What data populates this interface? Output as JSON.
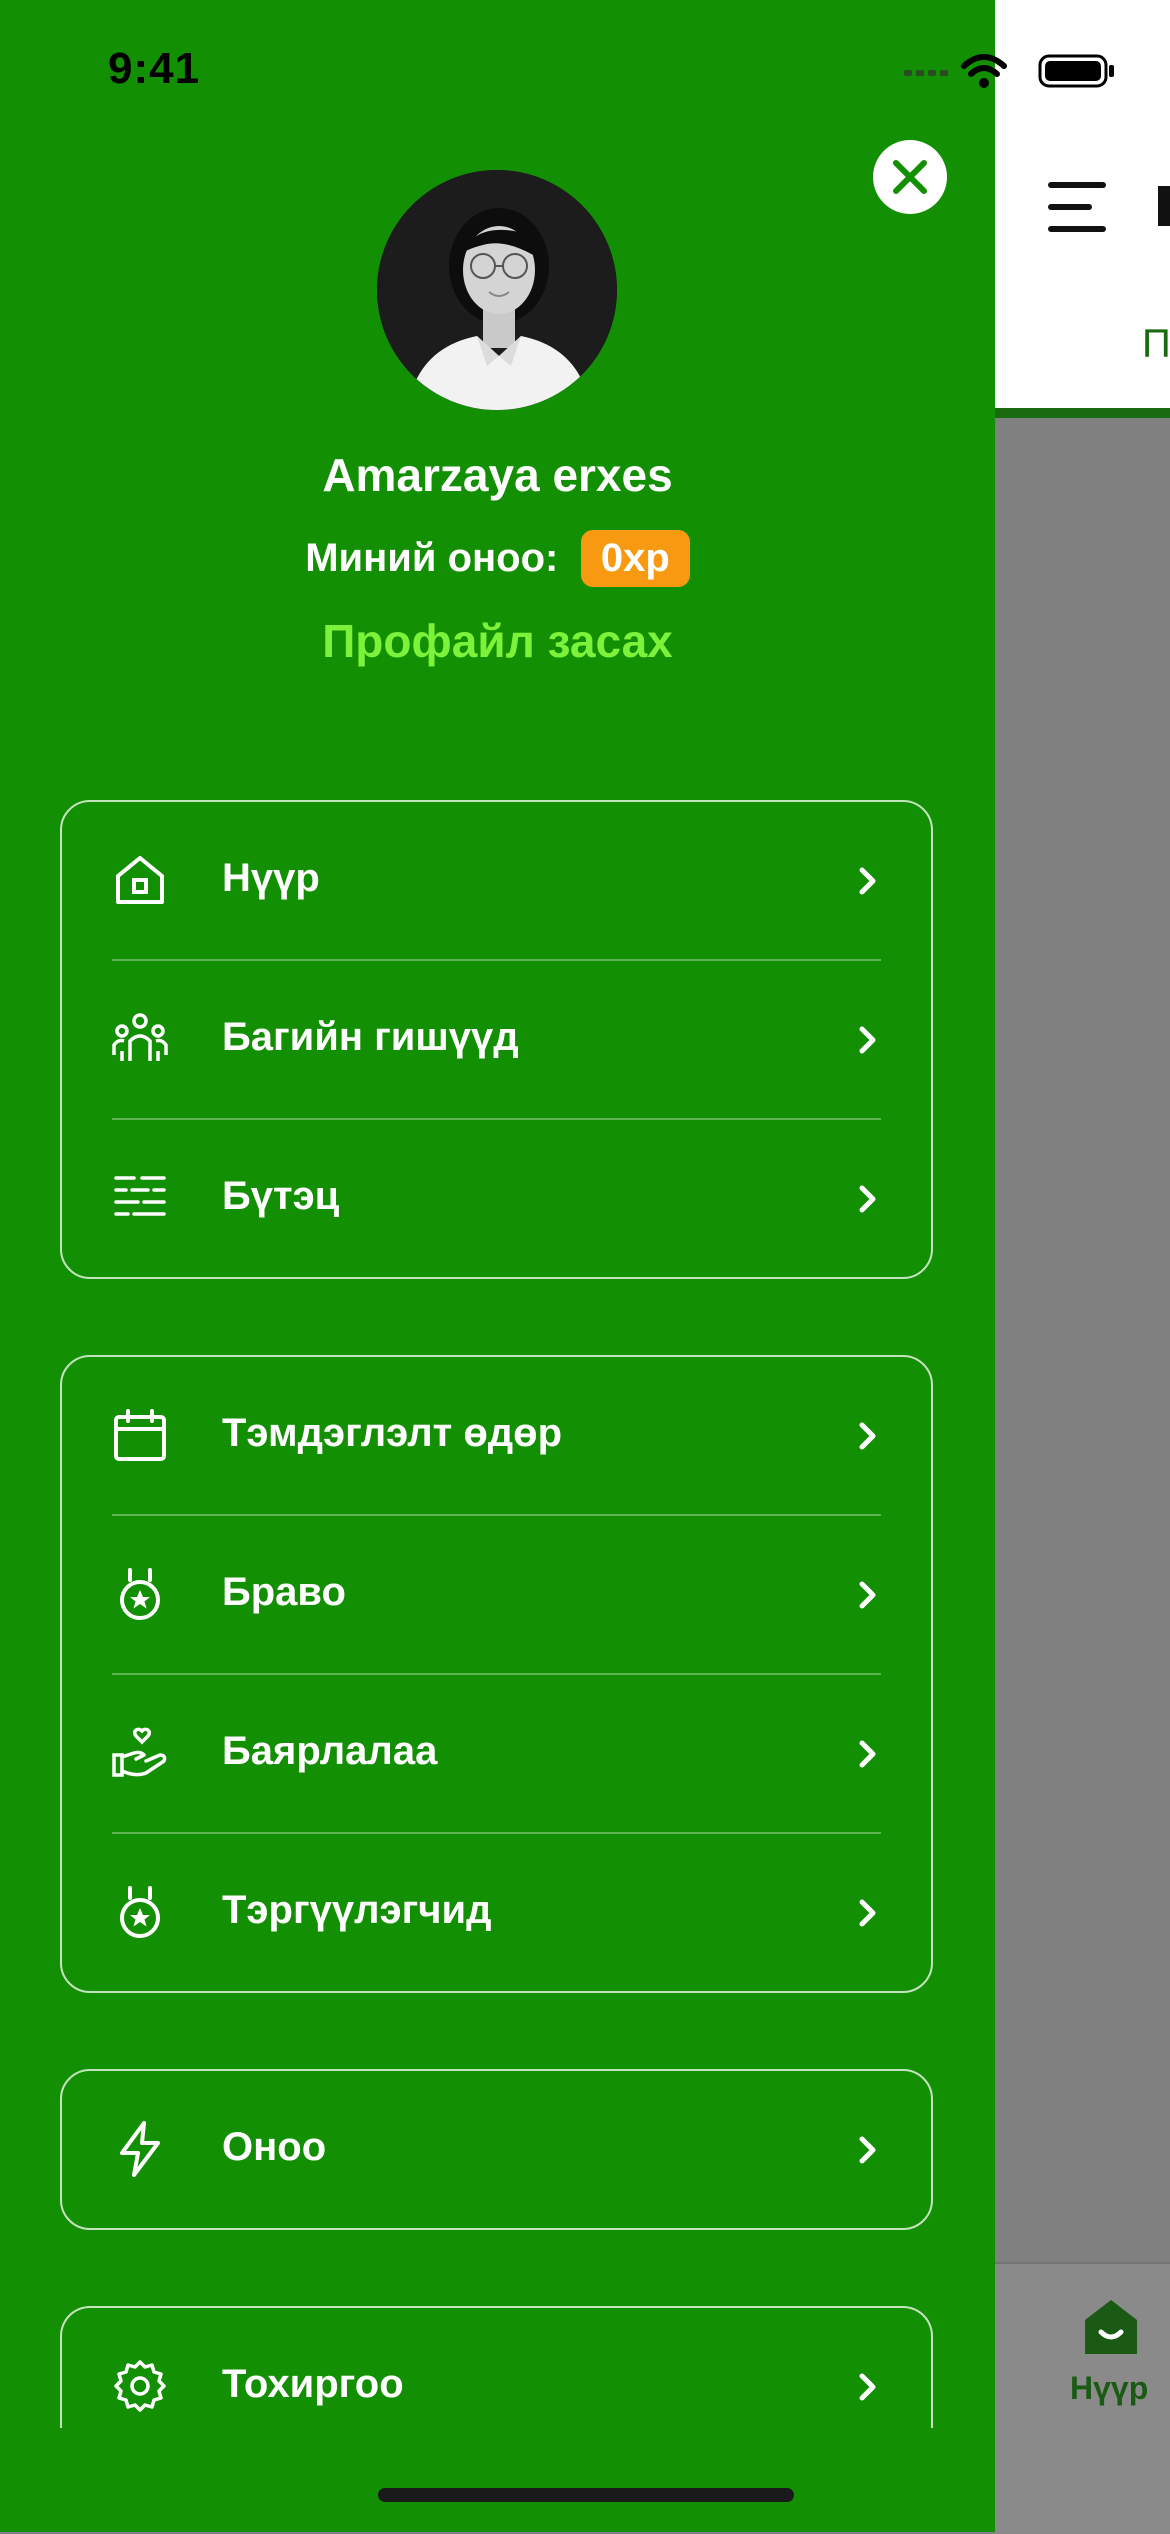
{
  "status_bar": {
    "time": "9:41"
  },
  "profile": {
    "name": "Amarzaya erxes",
    "points_label": "Миний оноо:",
    "points_value": "0xp",
    "edit_link": "Профайл засах"
  },
  "menu": {
    "group1": [
      {
        "label": "Нүүр",
        "icon": "home-icon"
      },
      {
        "label": "Багийн гишүүд",
        "icon": "team-members-icon"
      },
      {
        "label": "Бүтэц",
        "icon": "structure-icon"
      }
    ],
    "group2": [
      {
        "label": "Тэмдэглэлт өдөр",
        "icon": "calendar-icon"
      },
      {
        "label": "Браво",
        "icon": "medal-icon"
      },
      {
        "label": "Баярлалаа",
        "icon": "hand-heart-icon"
      },
      {
        "label": "Тэргүүлэгчид",
        "icon": "medal-icon"
      }
    ],
    "group3": [
      {
        "label": "Оноо",
        "icon": "lightning-icon"
      }
    ],
    "group4": [
      {
        "label": "Тохиргоо",
        "icon": "gear-icon"
      }
    ]
  },
  "background_app": {
    "tab_partial": "П",
    "bottom_tab_label": "Нүүр"
  },
  "colors": {
    "drawer": "#138f03",
    "accent_badge": "#f79a12",
    "edit_link": "#7cf23a",
    "overlay": "#808080"
  }
}
